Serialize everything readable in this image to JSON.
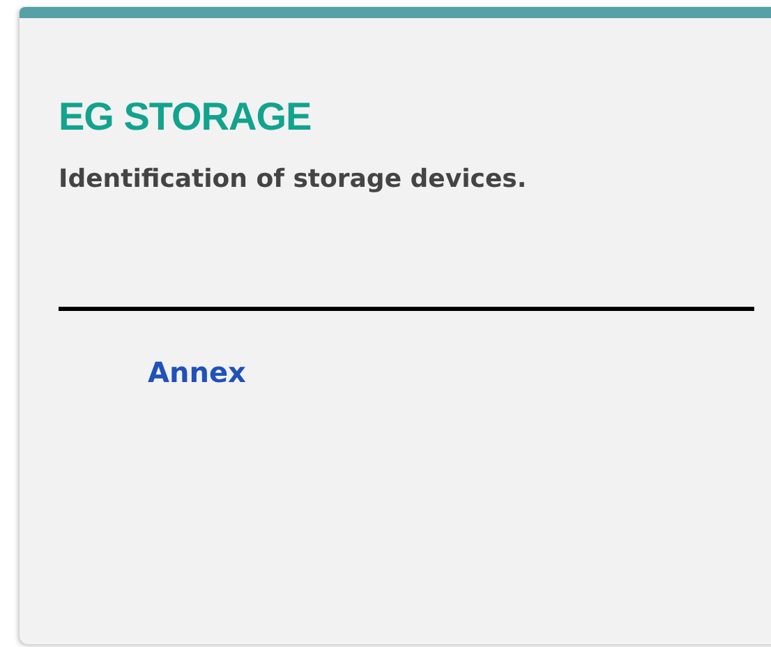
{
  "card": {
    "title": "EG STORAGE",
    "description": "Identification of storage devices.",
    "links": [
      "Annex"
    ]
  }
}
